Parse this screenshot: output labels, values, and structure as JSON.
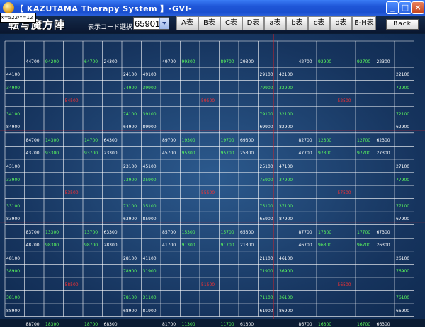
{
  "window": {
    "title": "【 KAZUTAMA Therapy System 】-GVI-",
    "minimize_label": "_",
    "maximize_label": "□",
    "close_label": "×"
  },
  "coord_readout": "X=522/Y=12",
  "header": {
    "title": "転写魔方陣",
    "select_label": "表示コード選択",
    "selected_code": "65901",
    "table_buttons": [
      "A表",
      "B表",
      "C表",
      "D表",
      "a表",
      "b表",
      "c表",
      "d表",
      "E-H表"
    ],
    "back_label": "Back"
  },
  "colors": {
    "white": "#ffffff",
    "green": "#5cff5c",
    "red": "#ff3030",
    "background": "#1c4274"
  },
  "grid": {
    "cells": [
      {
        "r": 1,
        "c": 1,
        "t": "44700",
        "k": "w"
      },
      {
        "r": 1,
        "c": 2,
        "t": "94200",
        "k": "g"
      },
      {
        "r": 1,
        "c": 4,
        "t": "64700",
        "k": "g"
      },
      {
        "r": 1,
        "c": 5,
        "t": "24300",
        "k": "w"
      },
      {
        "r": 2,
        "c": 0,
        "t": "44100",
        "k": "w"
      },
      {
        "r": 2,
        "c": 6,
        "t": "24100",
        "k": "w"
      },
      {
        "r": 3,
        "c": 0,
        "t": "34900",
        "k": "g"
      },
      {
        "r": 3,
        "c": 6,
        "t": "74900",
        "k": "g"
      },
      {
        "r": 4,
        "c": 3,
        "t": "54500",
        "k": "r"
      },
      {
        "r": 5,
        "c": 0,
        "t": "34100",
        "k": "g"
      },
      {
        "r": 5,
        "c": 6,
        "t": "74100",
        "k": "g"
      },
      {
        "r": 6,
        "c": 0,
        "t": "84900",
        "k": "w"
      },
      {
        "r": 6,
        "c": 6,
        "t": "64900",
        "k": "w"
      },
      {
        "r": 7,
        "c": 1,
        "t": "84700",
        "k": "w"
      },
      {
        "r": 7,
        "c": 2,
        "t": "14300",
        "k": "g"
      },
      {
        "r": 7,
        "c": 4,
        "t": "14700",
        "k": "g"
      },
      {
        "r": 7,
        "c": 5,
        "t": "64300",
        "k": "w"
      },
      {
        "r": 1,
        "c": 8,
        "t": "49700",
        "k": "w"
      },
      {
        "r": 1,
        "c": 9,
        "t": "99300",
        "k": "g"
      },
      {
        "r": 1,
        "c": 11,
        "t": "89700",
        "k": "g"
      },
      {
        "r": 1,
        "c": 12,
        "t": "29300",
        "k": "w"
      },
      {
        "r": 2,
        "c": 7,
        "t": "49100",
        "k": "w"
      },
      {
        "r": 2,
        "c": 13,
        "t": "29100",
        "k": "w"
      },
      {
        "r": 3,
        "c": 7,
        "t": "39900",
        "k": "g"
      },
      {
        "r": 3,
        "c": 13,
        "t": "79900",
        "k": "g"
      },
      {
        "r": 4,
        "c": 10,
        "t": "59500",
        "k": "r"
      },
      {
        "r": 5,
        "c": 7,
        "t": "39100",
        "k": "g"
      },
      {
        "r": 5,
        "c": 13,
        "t": "79100",
        "k": "g"
      },
      {
        "r": 6,
        "c": 7,
        "t": "89900",
        "k": "w"
      },
      {
        "r": 6,
        "c": 13,
        "t": "69900",
        "k": "w"
      },
      {
        "r": 7,
        "c": 8,
        "t": "89700",
        "k": "w"
      },
      {
        "r": 7,
        "c": 9,
        "t": "19300",
        "k": "g"
      },
      {
        "r": 7,
        "c": 11,
        "t": "19700",
        "k": "g"
      },
      {
        "r": 7,
        "c": 12,
        "t": "69300",
        "k": "w"
      },
      {
        "r": 1,
        "c": 15,
        "t": "42700",
        "k": "w"
      },
      {
        "r": 1,
        "c": 16,
        "t": "92900",
        "k": "g"
      },
      {
        "r": 1,
        "c": 18,
        "t": "92700",
        "k": "g"
      },
      {
        "r": 1,
        "c": 19,
        "t": "22300",
        "k": "w"
      },
      {
        "r": 2,
        "c": 14,
        "t": "42100",
        "k": "w"
      },
      {
        "r": 2,
        "c": 20,
        "t": "22100",
        "k": "w"
      },
      {
        "r": 3,
        "c": 14,
        "t": "32900",
        "k": "g"
      },
      {
        "r": 3,
        "c": 20,
        "t": "72900",
        "k": "g"
      },
      {
        "r": 4,
        "c": 17,
        "t": "52500",
        "k": "r"
      },
      {
        "r": 5,
        "c": 14,
        "t": "32100",
        "k": "g"
      },
      {
        "r": 5,
        "c": 20,
        "t": "72100",
        "k": "g"
      },
      {
        "r": 6,
        "c": 14,
        "t": "82900",
        "k": "w"
      },
      {
        "r": 6,
        "c": 20,
        "t": "62900",
        "k": "w"
      },
      {
        "r": 7,
        "c": 15,
        "t": "82700",
        "k": "w"
      },
      {
        "r": 7,
        "c": 16,
        "t": "12300",
        "k": "g"
      },
      {
        "r": 7,
        "c": 18,
        "t": "12700",
        "k": "g"
      },
      {
        "r": 7,
        "c": 19,
        "t": "62300",
        "k": "w"
      },
      {
        "r": 8,
        "c": 1,
        "t": "43700",
        "k": "w"
      },
      {
        "r": 8,
        "c": 2,
        "t": "93300",
        "k": "g"
      },
      {
        "r": 8,
        "c": 4,
        "t": "93700",
        "k": "g"
      },
      {
        "r": 8,
        "c": 5,
        "t": "23300",
        "k": "w"
      },
      {
        "r": 9,
        "c": 0,
        "t": "43100",
        "k": "w"
      },
      {
        "r": 9,
        "c": 6,
        "t": "23100",
        "k": "w"
      },
      {
        "r": 10,
        "c": 0,
        "t": "33900",
        "k": "g"
      },
      {
        "r": 10,
        "c": 6,
        "t": "73900",
        "k": "g"
      },
      {
        "r": 11,
        "c": 3,
        "t": "53500",
        "k": "r"
      },
      {
        "r": 12,
        "c": 0,
        "t": "33100",
        "k": "g"
      },
      {
        "r": 12,
        "c": 6,
        "t": "73100",
        "k": "g"
      },
      {
        "r": 13,
        "c": 0,
        "t": "83900",
        "k": "w"
      },
      {
        "r": 13,
        "c": 6,
        "t": "63900",
        "k": "w"
      },
      {
        "r": 14,
        "c": 1,
        "t": "83700",
        "k": "w"
      },
      {
        "r": 14,
        "c": 2,
        "t": "13300",
        "k": "g"
      },
      {
        "r": 14,
        "c": 4,
        "t": "13700",
        "k": "g"
      },
      {
        "r": 14,
        "c": 5,
        "t": "63300",
        "k": "w"
      },
      {
        "r": 8,
        "c": 8,
        "t": "45700",
        "k": "w"
      },
      {
        "r": 8,
        "c": 9,
        "t": "95300",
        "k": "g"
      },
      {
        "r": 8,
        "c": 11,
        "t": "95700",
        "k": "g"
      },
      {
        "r": 8,
        "c": 12,
        "t": "25300",
        "k": "w"
      },
      {
        "r": 9,
        "c": 7,
        "t": "45100",
        "k": "w"
      },
      {
        "r": 9,
        "c": 13,
        "t": "25100",
        "k": "w"
      },
      {
        "r": 10,
        "c": 7,
        "t": "35900",
        "k": "g"
      },
      {
        "r": 10,
        "c": 13,
        "t": "75900",
        "k": "g"
      },
      {
        "r": 11,
        "c": 10,
        "t": "55500",
        "k": "r"
      },
      {
        "r": 12,
        "c": 7,
        "t": "35100",
        "k": "g"
      },
      {
        "r": 12,
        "c": 13,
        "t": "75100",
        "k": "g"
      },
      {
        "r": 13,
        "c": 7,
        "t": "85900",
        "k": "w"
      },
      {
        "r": 13,
        "c": 13,
        "t": "65900",
        "k": "w"
      },
      {
        "r": 14,
        "c": 8,
        "t": "85700",
        "k": "w"
      },
      {
        "r": 14,
        "c": 9,
        "t": "15300",
        "k": "g"
      },
      {
        "r": 14,
        "c": 11,
        "t": "15700",
        "k": "g"
      },
      {
        "r": 14,
        "c": 12,
        "t": "65300",
        "k": "w"
      },
      {
        "r": 8,
        "c": 15,
        "t": "47700",
        "k": "w"
      },
      {
        "r": 8,
        "c": 16,
        "t": "97300",
        "k": "g"
      },
      {
        "r": 8,
        "c": 18,
        "t": "97700",
        "k": "g"
      },
      {
        "r": 8,
        "c": 19,
        "t": "27300",
        "k": "w"
      },
      {
        "r": 9,
        "c": 14,
        "t": "47100",
        "k": "w"
      },
      {
        "r": 9,
        "c": 20,
        "t": "27100",
        "k": "w"
      },
      {
        "r": 10,
        "c": 14,
        "t": "37900",
        "k": "g"
      },
      {
        "r": 10,
        "c": 20,
        "t": "77900",
        "k": "g"
      },
      {
        "r": 11,
        "c": 17,
        "t": "57500",
        "k": "r"
      },
      {
        "r": 12,
        "c": 14,
        "t": "37100",
        "k": "g"
      },
      {
        "r": 12,
        "c": 20,
        "t": "77100",
        "k": "g"
      },
      {
        "r": 13,
        "c": 14,
        "t": "87900",
        "k": "w"
      },
      {
        "r": 13,
        "c": 20,
        "t": "67900",
        "k": "w"
      },
      {
        "r": 14,
        "c": 15,
        "t": "87700",
        "k": "w"
      },
      {
        "r": 14,
        "c": 16,
        "t": "17300",
        "k": "g"
      },
      {
        "r": 14,
        "c": 18,
        "t": "17700",
        "k": "g"
      },
      {
        "r": 14,
        "c": 19,
        "t": "67300",
        "k": "w"
      },
      {
        "r": 15,
        "c": 1,
        "t": "48700",
        "k": "w"
      },
      {
        "r": 15,
        "c": 2,
        "t": "98300",
        "k": "g"
      },
      {
        "r": 15,
        "c": 4,
        "t": "98700",
        "k": "g"
      },
      {
        "r": 15,
        "c": 5,
        "t": "28300",
        "k": "w"
      },
      {
        "r": 16,
        "c": 0,
        "t": "48100",
        "k": "w"
      },
      {
        "r": 16,
        "c": 6,
        "t": "28100",
        "k": "w"
      },
      {
        "r": 17,
        "c": 0,
        "t": "38900",
        "k": "g"
      },
      {
        "r": 17,
        "c": 6,
        "t": "78900",
        "k": "g"
      },
      {
        "r": 18,
        "c": 3,
        "t": "58500",
        "k": "r"
      },
      {
        "r": 19,
        "c": 0,
        "t": "38100",
        "k": "g"
      },
      {
        "r": 19,
        "c": 6,
        "t": "78100",
        "k": "g"
      },
      {
        "r": 20,
        "c": 0,
        "t": "88900",
        "k": "w"
      },
      {
        "r": 20,
        "c": 6,
        "t": "68900",
        "k": "w"
      },
      {
        "r": 21,
        "c": 1,
        "t": "88700",
        "k": "w"
      },
      {
        "r": 21,
        "c": 2,
        "t": "18300",
        "k": "g"
      },
      {
        "r": 21,
        "c": 4,
        "t": "18700",
        "k": "g"
      },
      {
        "r": 21,
        "c": 5,
        "t": "68300",
        "k": "w"
      },
      {
        "r": 15,
        "c": 8,
        "t": "41700",
        "k": "w"
      },
      {
        "r": 15,
        "c": 9,
        "t": "91300",
        "k": "g"
      },
      {
        "r": 15,
        "c": 11,
        "t": "91700",
        "k": "g"
      },
      {
        "r": 15,
        "c": 12,
        "t": "21300",
        "k": "w"
      },
      {
        "r": 16,
        "c": 7,
        "t": "41100",
        "k": "w"
      },
      {
        "r": 16,
        "c": 13,
        "t": "21100",
        "k": "w"
      },
      {
        "r": 17,
        "c": 7,
        "t": "31900",
        "k": "g"
      },
      {
        "r": 17,
        "c": 13,
        "t": "71900",
        "k": "g"
      },
      {
        "r": 18,
        "c": 10,
        "t": "51500",
        "k": "r"
      },
      {
        "r": 19,
        "c": 7,
        "t": "31100",
        "k": "g"
      },
      {
        "r": 19,
        "c": 13,
        "t": "71100",
        "k": "g"
      },
      {
        "r": 20,
        "c": 7,
        "t": "81900",
        "k": "w"
      },
      {
        "r": 20,
        "c": 13,
        "t": "61900",
        "k": "w"
      },
      {
        "r": 21,
        "c": 8,
        "t": "81700",
        "k": "w"
      },
      {
        "r": 21,
        "c": 9,
        "t": "11300",
        "k": "g"
      },
      {
        "r": 21,
        "c": 11,
        "t": "11700",
        "k": "g"
      },
      {
        "r": 21,
        "c": 12,
        "t": "61300",
        "k": "w"
      },
      {
        "r": 15,
        "c": 15,
        "t": "46700",
        "k": "w"
      },
      {
        "r": 15,
        "c": 16,
        "t": "96300",
        "k": "g"
      },
      {
        "r": 15,
        "c": 18,
        "t": "96700",
        "k": "g"
      },
      {
        "r": 15,
        "c": 19,
        "t": "26300",
        "k": "w"
      },
      {
        "r": 16,
        "c": 14,
        "t": "46100",
        "k": "w"
      },
      {
        "r": 16,
        "c": 20,
        "t": "26100",
        "k": "w"
      },
      {
        "r": 17,
        "c": 14,
        "t": "36900",
        "k": "g"
      },
      {
        "r": 17,
        "c": 20,
        "t": "76900",
        "k": "g"
      },
      {
        "r": 18,
        "c": 17,
        "t": "56500",
        "k": "r"
      },
      {
        "r": 19,
        "c": 14,
        "t": "36100",
        "k": "g"
      },
      {
        "r": 19,
        "c": 20,
        "t": "76100",
        "k": "g"
      },
      {
        "r": 20,
        "c": 14,
        "t": "86900",
        "k": "w"
      },
      {
        "r": 20,
        "c": 20,
        "t": "66900",
        "k": "w"
      },
      {
        "r": 21,
        "c": 15,
        "t": "86700",
        "k": "w"
      },
      {
        "r": 21,
        "c": 16,
        "t": "16300",
        "k": "g"
      },
      {
        "r": 21,
        "c": 18,
        "t": "16700",
        "k": "g"
      },
      {
        "r": 21,
        "c": 19,
        "t": "66300",
        "k": "w"
      }
    ]
  }
}
